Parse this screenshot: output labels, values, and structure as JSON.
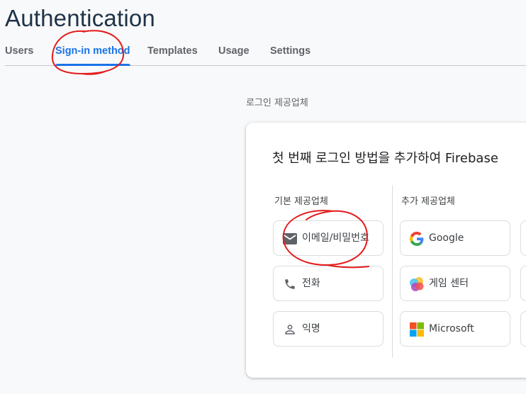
{
  "header": {
    "title": "Authentication"
  },
  "tabs": [
    {
      "label": "Users"
    },
    {
      "label": "Sign-in method",
      "active": true
    },
    {
      "label": "Templates"
    },
    {
      "label": "Usage"
    },
    {
      "label": "Settings"
    }
  ],
  "providers_section": {
    "label": "로그인 제공업체",
    "headline": "첫 번째 로그인 방법을 추가하여 Firebase",
    "native": {
      "label": "기본 제공업체",
      "items": [
        {
          "label": "이메일/비밀번호",
          "icon": "mail-icon"
        },
        {
          "label": "전화",
          "icon": "phone-icon"
        },
        {
          "label": "익명",
          "icon": "person-icon"
        }
      ]
    },
    "additional": {
      "label": "추가 제공업체",
      "items": [
        {
          "label": "Google",
          "icon": "google-logo-icon"
        },
        {
          "label": "게임 센터",
          "icon": "game-center-icon"
        },
        {
          "label": "Microsoft",
          "icon": "microsoft-logo-icon"
        }
      ]
    }
  },
  "colors": {
    "accent": "#1a73e8",
    "title": "#1f3347",
    "annotation": "#e41b1b"
  }
}
